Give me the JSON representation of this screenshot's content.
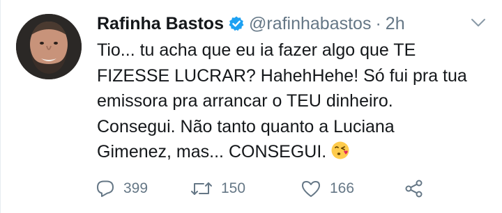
{
  "author": {
    "name": "Rafinha Bastos",
    "handle": "@rafinhabastos",
    "separator": "·",
    "time": "2h",
    "verified": true
  },
  "tweet": {
    "lines": [
      "Tio... tu acha que eu ia fazer algo que TE",
      "FIZESSE LUCRAR? HahehHehe! Só fui pra tua",
      "emissora pra arrancar o TEU dinheiro.",
      "Consegui. Não tanto quanto a Luciana",
      "Gimenez, mas... CONSEGUI."
    ],
    "emoji": "face-blowing-kiss-emoji"
  },
  "actions": {
    "replies": "399",
    "retweets": "150",
    "likes": "166"
  },
  "colors": {
    "text": "#14171a",
    "secondary": "#657786",
    "verified": "#1da1f2",
    "divider": "#e6ecf0"
  }
}
